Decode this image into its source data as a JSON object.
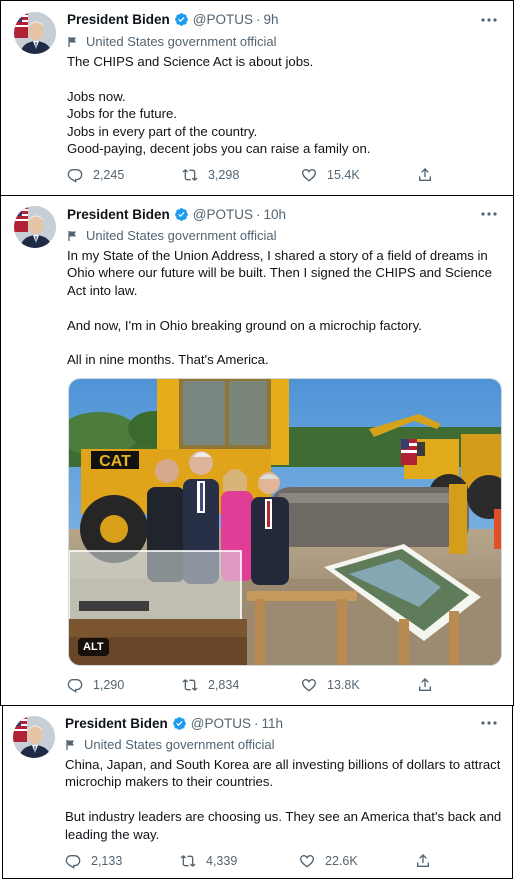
{
  "tweets": [
    {
      "author": {
        "name": "President Biden",
        "handle": "@POTUS",
        "time": "9h",
        "label": "United States government official"
      },
      "lines": [
        "The CHIPS and Science Act is about jobs.",
        "",
        "Jobs now.",
        "Jobs for the future.",
        "Jobs in every part of the country.",
        "Good-paying, decent jobs you can raise a family on."
      ],
      "stats": {
        "replies": "2,245",
        "retweets": "3,298",
        "likes": "15.4K"
      }
    },
    {
      "author": {
        "name": "President Biden",
        "handle": "@POTUS",
        "time": "10h",
        "label": "United States government official"
      },
      "lines": [
        "In my State of the Union Address, I shared a story of a field of dreams in",
        "Ohio where our future will be built. Then I signed the CHIPS and Science",
        "Act into law.",
        "",
        "And now, I'm in Ohio breaking ground on a microchip factory.",
        "",
        "All in nine months. That's America."
      ],
      "media": {
        "alt_badge": "ALT",
        "machine_text": "CAT"
      },
      "stats": {
        "replies": "1,290",
        "retweets": "2,834",
        "likes": "13.8K"
      }
    },
    {
      "author": {
        "name": "President Biden",
        "handle": "@POTUS",
        "time": "11h",
        "label": "United States government official"
      },
      "lines": [
        "China, Japan, and South Korea are all investing billions of dollars to attract",
        "microchip makers to their countries.",
        "",
        "But industry leaders are choosing us. They see an America that's back and",
        "leading the way."
      ],
      "stats": {
        "replies": "2,133",
        "retweets": "4,339",
        "likes": "22.6K"
      }
    }
  ],
  "icons": {
    "verified": "verified-badge-icon",
    "more": "more-options-icon",
    "official": "government-flag-icon",
    "reply": "reply-icon",
    "retweet": "retweet-icon",
    "like": "like-icon",
    "share": "share-icon"
  },
  "colors": {
    "verified": "#1d9bf0",
    "text": "#0f1419",
    "secondary": "#536471"
  }
}
